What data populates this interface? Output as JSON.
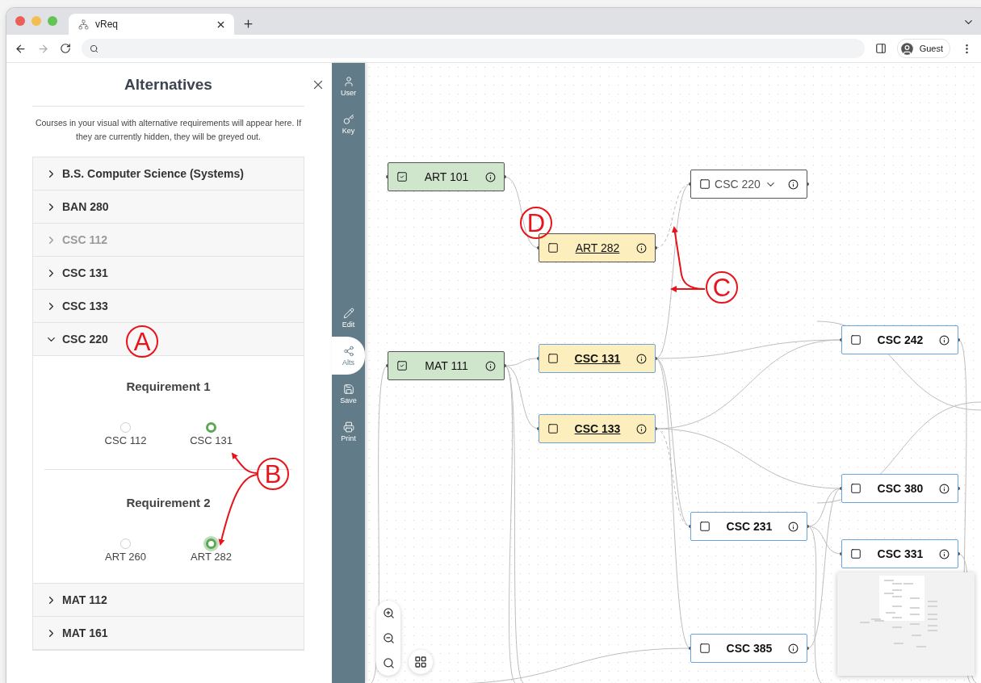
{
  "browser": {
    "tab_title": "vReq",
    "profile": "Guest"
  },
  "panel": {
    "title": "Alternatives",
    "description": "Courses in your visual with alternative requirements will appear here. If they are currently hidden, they will be greyed out.",
    "items": [
      {
        "label": "B.S. Computer Science (Systems)",
        "expanded": false,
        "hidden": false
      },
      {
        "label": "BAN 280",
        "expanded": false,
        "hidden": false
      },
      {
        "label": "CSC 112",
        "expanded": false,
        "hidden": true
      },
      {
        "label": "CSC 131",
        "expanded": false,
        "hidden": false
      },
      {
        "label": "CSC 133",
        "expanded": false,
        "hidden": false
      },
      {
        "label": "CSC 220",
        "expanded": true,
        "hidden": false,
        "requirements": [
          {
            "title": "Requirement 1",
            "options": [
              {
                "label": "CSC 112",
                "selected": false,
                "focused": false
              },
              {
                "label": "CSC 131",
                "selected": true,
                "focused": false
              }
            ]
          },
          {
            "title": "Requirement 2",
            "options": [
              {
                "label": "ART 260",
                "selected": false,
                "focused": false
              },
              {
                "label": "ART 282",
                "selected": true,
                "focused": true
              }
            ]
          }
        ]
      },
      {
        "label": "MAT 112",
        "expanded": false,
        "hidden": false
      },
      {
        "label": "MAT 161",
        "expanded": false,
        "hidden": false
      }
    ]
  },
  "toolbar": [
    {
      "label": "User",
      "selected": false
    },
    {
      "label": "Key",
      "selected": false
    },
    {
      "label": "Edit",
      "selected": false
    },
    {
      "label": "Alts",
      "selected": true
    },
    {
      "label": "Save",
      "selected": false
    },
    {
      "label": "Print",
      "selected": false
    }
  ],
  "nodes": [
    {
      "label": "ART 101",
      "kind": "taken",
      "checked": true,
      "bold": false,
      "underlined": false,
      "expandable": false
    },
    {
      "label": "CSC 220",
      "kind": "group",
      "checked": false,
      "bold": false,
      "underlined": false,
      "expandable": true
    },
    {
      "label": "ART 282",
      "kind": "alternative",
      "checked": false,
      "bold": false,
      "underlined": true,
      "expandable": false
    },
    {
      "label": "CSC 242",
      "kind": "course",
      "checked": false,
      "bold": true,
      "underlined": false,
      "expandable": false
    },
    {
      "label": "MAT 111",
      "kind": "taken",
      "checked": true,
      "bold": false,
      "underlined": false,
      "expandable": false
    },
    {
      "label": "CSC 131",
      "kind": "alternative",
      "checked": false,
      "bold": true,
      "underlined": true,
      "expandable": false
    },
    {
      "label": "CSC 133",
      "kind": "alternative",
      "checked": false,
      "bold": true,
      "underlined": true,
      "expandable": false
    },
    {
      "label": "CSC 380",
      "kind": "course",
      "checked": false,
      "bold": true,
      "underlined": false,
      "expandable": false
    },
    {
      "label": "CSC 231",
      "kind": "course",
      "checked": false,
      "bold": true,
      "underlined": false,
      "expandable": false
    },
    {
      "label": "CSC 331",
      "kind": "course",
      "checked": false,
      "bold": true,
      "underlined": false,
      "expandable": false
    },
    {
      "label": "CSC 385",
      "kind": "course",
      "checked": false,
      "bold": true,
      "underlined": false,
      "expandable": false
    }
  ],
  "annotations": [
    {
      "label": "A"
    },
    {
      "label": "B"
    },
    {
      "label": "C"
    },
    {
      "label": "D"
    }
  ]
}
